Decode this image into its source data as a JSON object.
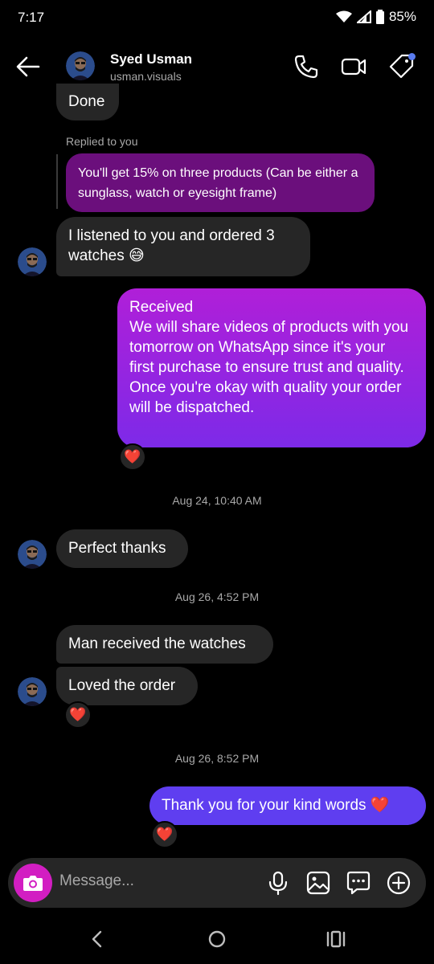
{
  "status": {
    "time": "7:17",
    "battery": "85%"
  },
  "contact": {
    "name": "Syed Usman",
    "username": "usman.visuals"
  },
  "messages": {
    "done": "Done",
    "replied_label": "Replied to you",
    "reply_quote": "You'll get 15% on three products (Can be either a sunglass, watch or eyesight frame)",
    "ordered": "I listened to you and ordered 3 watches 😅",
    "received": "Received\nWe will share videos of products with you tomorrow on WhatsApp since it's your first purchase to ensure trust and quality.\nOnce you're okay with quality your order will be dispatched.",
    "ts1": "Aug 24, 10:40 AM",
    "perfect": "Perfect thanks",
    "ts2": "Aug 26, 4:52 PM",
    "man_received": "Man received the watches",
    "loved": "Loved the order",
    "ts3": "Aug 26, 8:52 PM",
    "thank_you": "Thank you for your kind words ❤️"
  },
  "reaction": "❤️",
  "composer": {
    "placeholder": "Message..."
  },
  "colors": {
    "bubble_incoming": "#262626",
    "reply_bubble": "#6b0f7c",
    "bubble_out_purple_top": "#b01fd8",
    "bubble_out_purple_bottom": "#7d2ae8",
    "bubble_out_blue": "#5f3ef0",
    "camera_button": "#d21ec2"
  }
}
